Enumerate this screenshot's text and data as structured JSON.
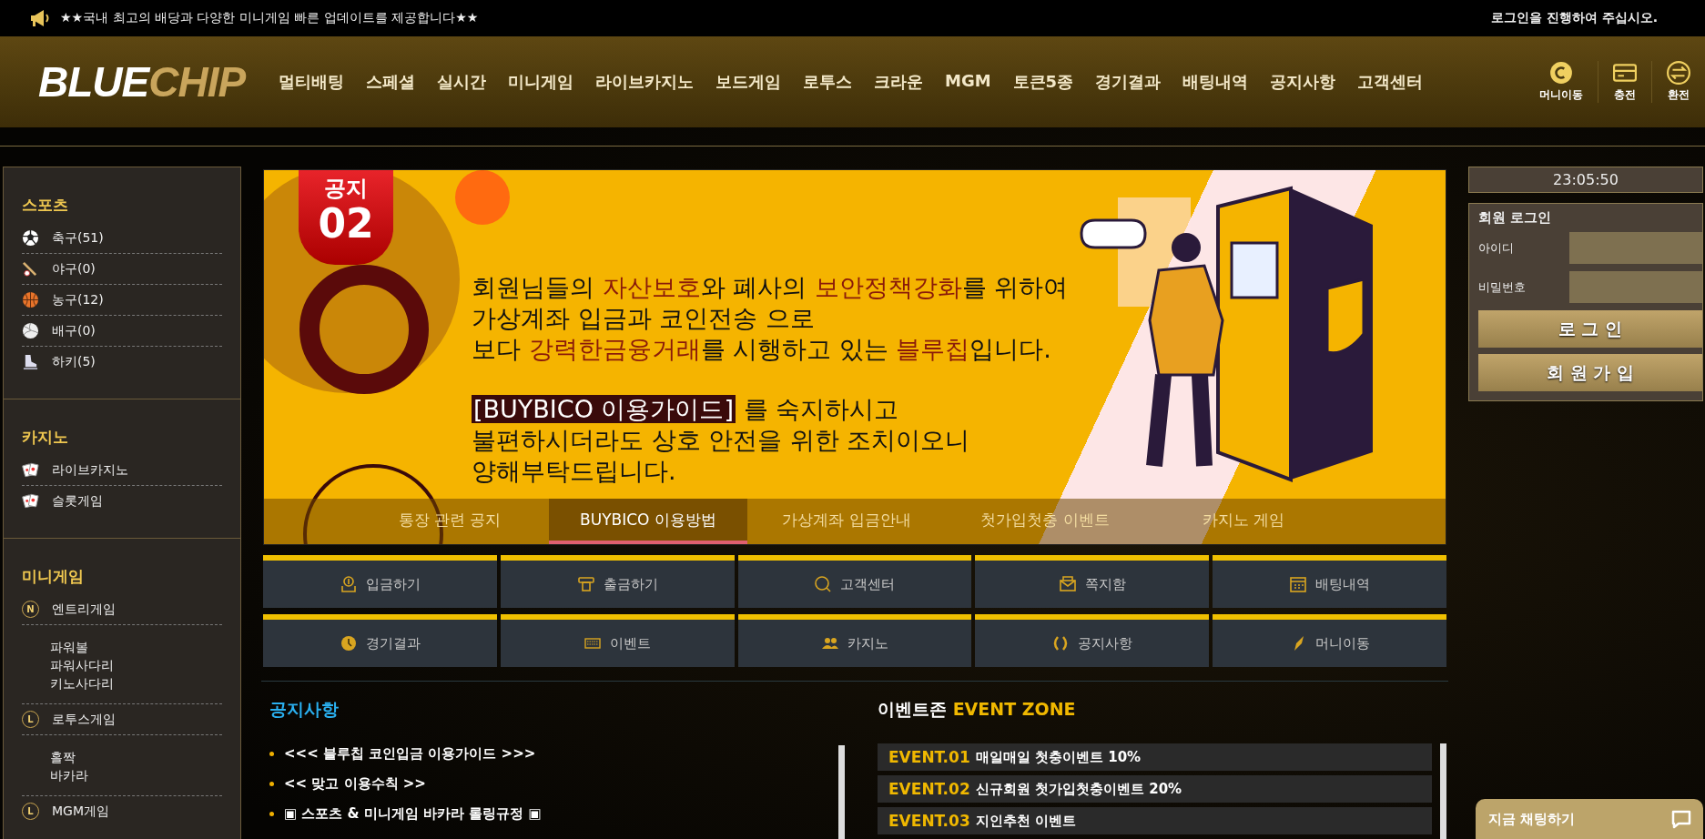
{
  "top_bar": {
    "announcement": "★★국내 최고의 배당과 다양한 미니게임 빠른 업데이트를 제공합니다★★",
    "login_prompt": "로그인을 진행하여 주십시오."
  },
  "header": {
    "logo": {
      "part1": "BLUE",
      "part2": "CHIP"
    },
    "nav": [
      "멀티배팅",
      "스페셜",
      "실시간",
      "미니게임",
      "라이브카지노",
      "보드게임",
      "로투스",
      "크라운",
      "MGM",
      "토큰5종",
      "경기결과",
      "배팅내역",
      "공지사항",
      "고객센터"
    ],
    "actions": [
      {
        "kind": "money",
        "label": "머니이동"
      },
      {
        "kind": "charge",
        "label": "충전"
      },
      {
        "kind": "exchange",
        "label": "환전"
      }
    ]
  },
  "sidebar": [
    {
      "title": "스포츠",
      "items": [
        {
          "kind": "soccer",
          "label": "축구(51)"
        },
        {
          "kind": "baseball",
          "label": "야구(0)"
        },
        {
          "kind": "basketball",
          "label": "농구(12)"
        },
        {
          "kind": "volleyball",
          "label": "배구(0)"
        },
        {
          "kind": "hockey",
          "label": "하키(5)"
        }
      ]
    },
    {
      "title": "카지노",
      "items": [
        {
          "kind": "cards",
          "label": "라이브카지노"
        },
        {
          "kind": "cards",
          "label": "슬롯게임"
        }
      ]
    },
    {
      "title": "미니게임",
      "items": [
        {
          "kind": "letter",
          "badge": "N",
          "label": "엔트리게임",
          "children": [
            "파워볼",
            "파워사다리",
            "키노사다리"
          ]
        },
        {
          "kind": "letter",
          "badge": "L",
          "label": "로투스게임",
          "children": [
            "홀짝",
            "바카라"
          ]
        },
        {
          "kind": "letter",
          "badge": "L",
          "label": "MGM게임"
        }
      ]
    }
  ],
  "clock": "23:05:50",
  "login": {
    "title": "회원 로그인",
    "fields": [
      {
        "label": "아이디"
      },
      {
        "label": "비밀번호"
      }
    ],
    "buttons": [
      "로 그 인",
      "회 원 가 입"
    ]
  },
  "banner": {
    "badge": {
      "top": "공지",
      "number": "02"
    },
    "paragraphs": [
      [
        [
          {
            "text": "회원님들의 "
          },
          {
            "text": "자산보호",
            "accent": true
          },
          {
            "text": "와 폐사의 "
          },
          {
            "text": "보안정책강화",
            "accent": true
          },
          {
            "text": "를 위하여"
          }
        ],
        [
          {
            "text": "가상계좌 입금과 코인전송 으로"
          }
        ],
        [
          {
            "text": "보다 "
          },
          {
            "text": "강력한금융거래",
            "accent": true
          },
          {
            "text": "를 시행하고 있는 "
          },
          {
            "text": "블루칩",
            "accent": true
          },
          {
            "text": "입니다."
          }
        ]
      ],
      [
        [
          {
            "text": "[BUYBICO 이용가이드]",
            "boxed": true
          },
          {
            "text": " 를 숙지하시고"
          }
        ],
        [
          {
            "text": "불편하시더라도 상호 안전을 위한 조치이오니"
          }
        ],
        [
          {
            "text": "양해부탁드립니다."
          }
        ]
      ]
    ],
    "tabs": [
      {
        "label": "통장 관련 공지",
        "selected": false
      },
      {
        "label": "BUYBICO 이용방법",
        "selected": true
      },
      {
        "label": "가상계좌 입금안내",
        "selected": false
      },
      {
        "label": "첫가입첫충 이벤트",
        "selected": false
      },
      {
        "label": "카지노 게임",
        "selected": false
      }
    ]
  },
  "quick_menu": [
    "입금하기",
    "출금하기",
    "고객센터",
    "쪽지함",
    "배팅내역",
    "경기결과",
    "이벤트",
    "카지노",
    "공지사항",
    "머니이동"
  ],
  "notices": {
    "title": "공지사항",
    "items": [
      "<<< 블루칩 코인입금 이용가이드 >>>",
      "<< 맞고 이용수칙 >>",
      "▣ 스포츠 & 미니게임 바카라 롤링규정 ▣"
    ]
  },
  "events": {
    "title": "이벤트존",
    "subtitle": "EVENT ZONE",
    "items": [
      {
        "number": "EVENT.01",
        "title": "매일매일 첫충이벤트 10%"
      },
      {
        "number": "EVENT.02",
        "title": "신규회원 첫가입첫충이벤트 20%"
      },
      {
        "number": "EVENT.03",
        "title": "지인추천 이벤트"
      }
    ]
  },
  "chat": {
    "label": "지금 채팅하기"
  }
}
